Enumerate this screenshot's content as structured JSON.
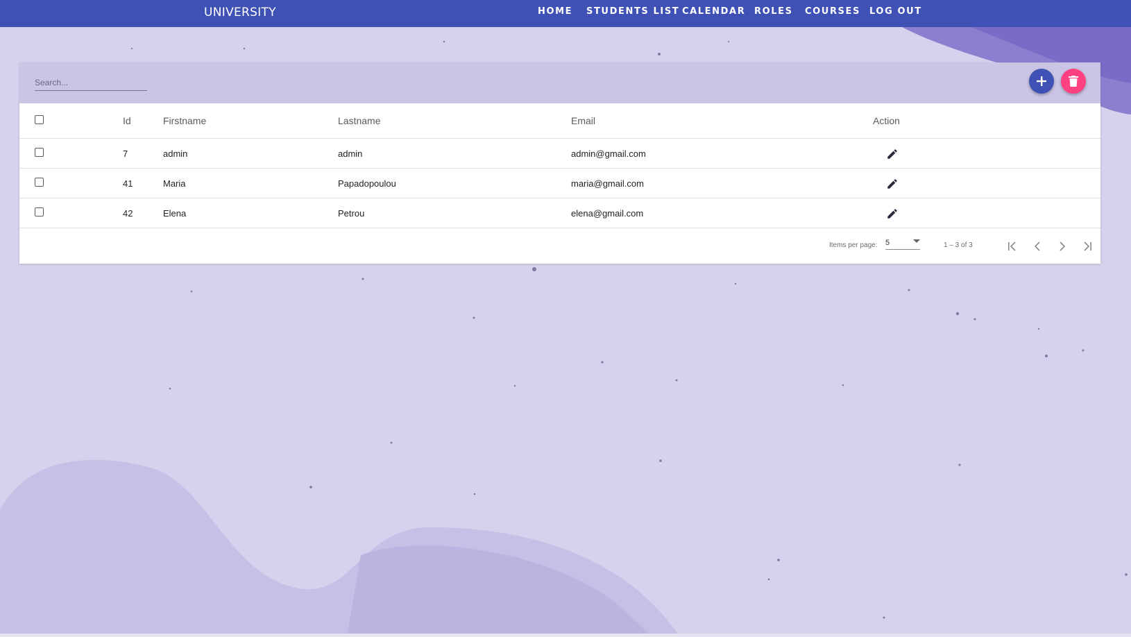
{
  "header": {
    "brand": "UNIVERSITY",
    "nav": [
      "HOME",
      "STUDENTS LIST",
      "CALENDAR",
      "ROLES",
      "COURSES",
      "LOG OUT"
    ]
  },
  "toolbar": {
    "search_placeholder": "Search...",
    "add_icon": "plus-icon",
    "delete_icon": "trash-icon",
    "add_color": "#3f51b5",
    "delete_color": "#ff4081"
  },
  "table": {
    "columns": [
      "Id",
      "Firstname",
      "Lastname",
      "Email",
      "Action"
    ],
    "rows": [
      {
        "id": "7",
        "firstname": "admin",
        "lastname": "admin",
        "email": "admin@gmail.com"
      },
      {
        "id": "41",
        "firstname": "Maria",
        "lastname": "Papadopoulou",
        "email": "maria@gmail.com"
      },
      {
        "id": "42",
        "firstname": "Elena",
        "lastname": "Petrou",
        "email": "elena@gmail.com"
      }
    ]
  },
  "paginator": {
    "items_per_page_label": "Items per page:",
    "page_size": "5",
    "range_label": "1 – 3 of 3"
  },
  "colors": {
    "navbar": "#3f51b5",
    "background": "#d6d1ec",
    "toolbar": "#cbc4e5"
  }
}
